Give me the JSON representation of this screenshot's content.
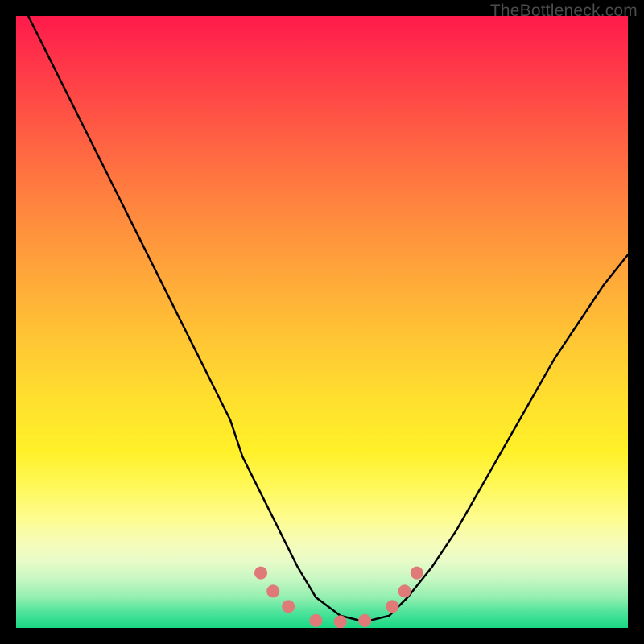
{
  "watermark": "TheBottleneck.com",
  "chart_data": {
    "type": "line",
    "title": "",
    "xlabel": "",
    "ylabel": "",
    "xlim": [
      0,
      100
    ],
    "ylim": [
      0,
      100
    ],
    "grid": false,
    "series": [
      {
        "name": "bottleneck-curve",
        "x": [
          0,
          2,
          5,
          8,
          11,
          14,
          17,
          20,
          23,
          26,
          29,
          32,
          35,
          37,
          40,
          43,
          46,
          49,
          53,
          57,
          61,
          64,
          68,
          72,
          76,
          80,
          84,
          88,
          92,
          96,
          100
        ],
        "y": [
          104,
          100,
          94,
          88,
          82,
          76,
          70,
          64,
          58,
          52,
          46,
          40,
          34,
          28,
          22,
          16,
          10,
          5,
          2,
          1,
          2,
          5,
          10,
          16,
          23,
          30,
          37,
          44,
          50,
          56,
          61
        ]
      }
    ],
    "markers": [
      {
        "name": "marker-left-1",
        "x": 40.0,
        "y": 9.0
      },
      {
        "name": "marker-left-2",
        "x": 42.0,
        "y": 6.0
      },
      {
        "name": "marker-left-3",
        "x": 44.5,
        "y": 3.5
      },
      {
        "name": "marker-bottom-1",
        "x": 49.0,
        "y": 1.2
      },
      {
        "name": "marker-bottom-2",
        "x": 53.0,
        "y": 1.0
      },
      {
        "name": "marker-bottom-3",
        "x": 57.0,
        "y": 1.2
      },
      {
        "name": "marker-right-1",
        "x": 61.5,
        "y": 3.5
      },
      {
        "name": "marker-right-2",
        "x": 63.5,
        "y": 6.0
      },
      {
        "name": "marker-right-3",
        "x": 65.5,
        "y": 9.0
      }
    ],
    "marker_style": {
      "color": "#e07a78",
      "radius_px": 8
    },
    "gradient_stops": [
      {
        "pct": 0,
        "color": "#ff1a4b"
      },
      {
        "pct": 50,
        "color": "#ffc634"
      },
      {
        "pct": 85,
        "color": "#fdfc8e"
      },
      {
        "pct": 100,
        "color": "#18d884"
      }
    ]
  }
}
